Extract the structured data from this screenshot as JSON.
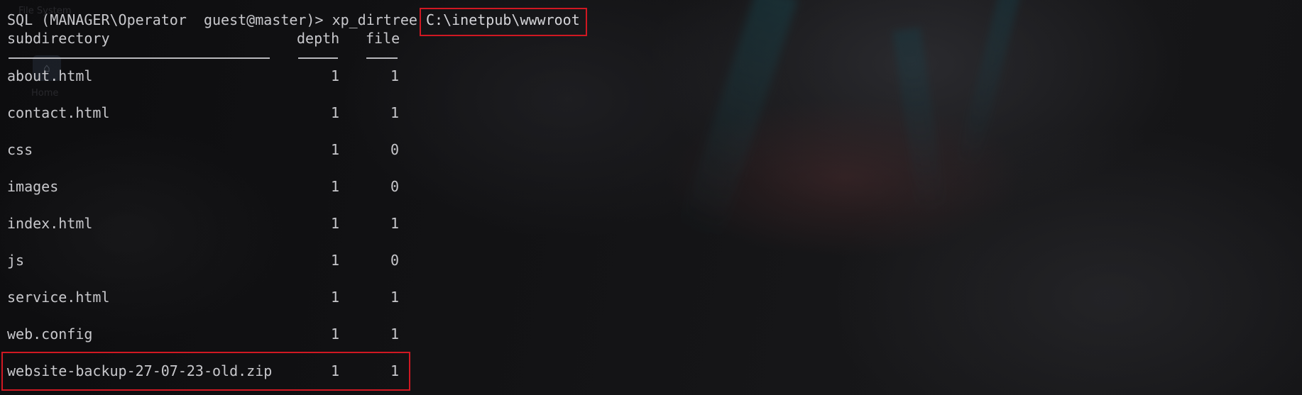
{
  "background": {
    "ghost_label_top": "File System",
    "ghost_label_home": "Home"
  },
  "terminal": {
    "prompt": "SQL (MANAGER\\Operator  guest@master)> ",
    "command": "xp_dirtree ",
    "argument": "C:\\inetpub\\wwwroot",
    "columns": {
      "subdirectory": "subdirectory",
      "depth": "depth",
      "file": "file"
    },
    "rows": [
      {
        "subdirectory": "about.html",
        "depth": "1",
        "file": "1"
      },
      {
        "subdirectory": "contact.html",
        "depth": "1",
        "file": "1"
      },
      {
        "subdirectory": "css",
        "depth": "1",
        "file": "0"
      },
      {
        "subdirectory": "images",
        "depth": "1",
        "file": "0"
      },
      {
        "subdirectory": "index.html",
        "depth": "1",
        "file": "1"
      },
      {
        "subdirectory": "js",
        "depth": "1",
        "file": "0"
      },
      {
        "subdirectory": "service.html",
        "depth": "1",
        "file": "1"
      },
      {
        "subdirectory": "web.config",
        "depth": "1",
        "file": "1"
      },
      {
        "subdirectory": "website-backup-27-07-23-old.zip",
        "depth": "1",
        "file": "1"
      }
    ]
  },
  "colors": {
    "terminal_text": "#c8c8cc",
    "highlight_border": "#d01822",
    "background": "#101012"
  },
  "icons": {
    "home": "home-icon"
  }
}
